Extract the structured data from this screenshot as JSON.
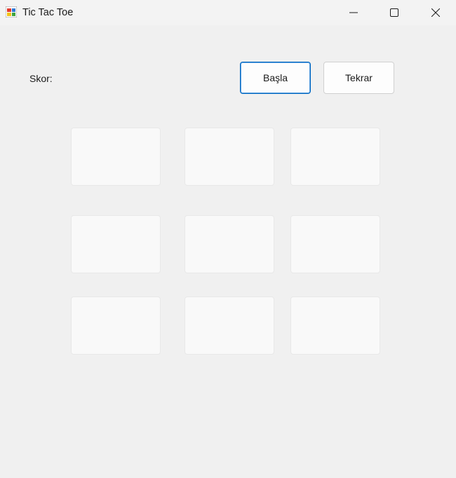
{
  "window": {
    "title": "Tic Tac Toe",
    "icon": "winforms-app-icon",
    "controls": {
      "minimize_icon": "minimize-icon",
      "maximize_icon": "maximize-icon",
      "close_icon": "close-icon"
    }
  },
  "score": {
    "label": "Skor:"
  },
  "buttons": {
    "start_label": "Başla",
    "reset_label": "Tekrar"
  },
  "board": {
    "cells": [
      "",
      "",
      "",
      "",
      "",
      "",
      "",
      "",
      ""
    ]
  },
  "colors": {
    "accent": "#0067c0",
    "background": "#f0f0f0",
    "cell_background": "#f9f9f9"
  }
}
